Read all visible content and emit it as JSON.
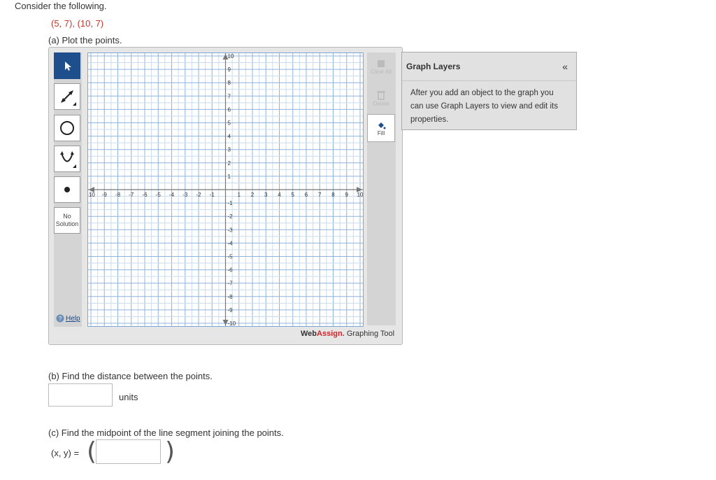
{
  "question": {
    "intro": "Consider the following.",
    "points": "(5, 7), (10, 7)",
    "part_a": "(a) Plot the points.",
    "part_b": "(b) Find the distance between the points.",
    "units": "units",
    "part_c": "(c) Find the midpoint of the line segment joining the points.",
    "xy_label": "(x, y) =",
    "distance_value": "",
    "midpoint_value": ""
  },
  "toolbar": {
    "no_solution_line1": "No",
    "no_solution_line2": "Solution",
    "help": "Help"
  },
  "right_tools": {
    "clear_all": "Clear All",
    "delete": "Delete",
    "fill": "Fill"
  },
  "brand": {
    "web": "Web",
    "assign": "Assign.",
    "rest": " Graphing Tool"
  },
  "layers": {
    "title": "Graph Layers",
    "collapse": "«",
    "description": "After you add an object to the graph you can use Graph Layers to view and edit its properties."
  },
  "graph": {
    "xmin": -10,
    "xmax": 10,
    "ymin": -10,
    "ymax": 10,
    "grid_step": 0.5,
    "label_step": 1
  }
}
